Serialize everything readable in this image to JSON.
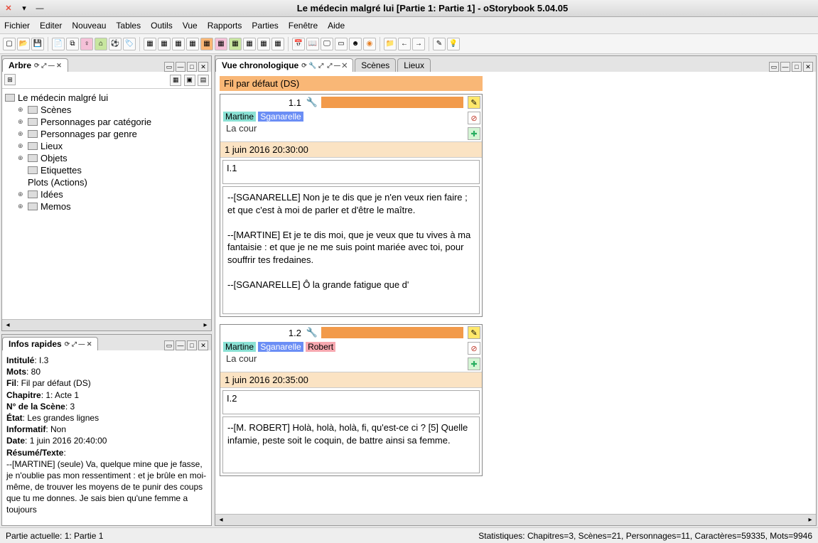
{
  "window": {
    "title": "Le médecin malgré lui [Partie 1: Partie 1] - oStorybook 5.04.05"
  },
  "menu": [
    "Fichier",
    "Editer",
    "Nouveau",
    "Tables",
    "Outils",
    "Vue",
    "Rapports",
    "Parties",
    "Fenêtre",
    "Aide"
  ],
  "panels": {
    "tree": {
      "title": "Arbre",
      "root": "Le médecin malgré lui",
      "items": [
        "Scènes",
        "Personnages par catégorie",
        "Personnages par genre",
        "Lieux",
        "Objets",
        "Etiquettes",
        "Plots (Actions)",
        "Idées",
        "Memos"
      ]
    },
    "infos": {
      "title": "Infos rapides",
      "fields": {
        "intitule_label": "Intitulé",
        "intitule": "I.3",
        "mots_label": "Mots",
        "mots": "80",
        "fil_label": "Fil",
        "fil": "Fil par défaut (DS)",
        "chap_label": "Chapitre",
        "chap": "1: Acte 1",
        "num_label": "N° de la Scène",
        "num": "3",
        "etat_label": "État",
        "etat": "Les grandes lignes",
        "info_label": "Informatif",
        "info": "Non",
        "date_label": "Date",
        "date": "1 juin 2016 20:40:00",
        "resume_label": "Résumé/Texte",
        "resume": "--[MARTINE] (seule) Va, quelque mine que je fasse, je n'oublie pas mon ressentiment : et je brûle en moi-même, de trouver les moyens de te punir des coups que tu me donnes. Je sais bien qu'une femme a toujours"
      }
    },
    "chrono": {
      "title": "Vue chronologique",
      "tabs": [
        "Scènes",
        "Lieux"
      ],
      "strand": "Fil par défaut (DS)",
      "scenes": [
        {
          "num": "1.1",
          "chars": [
            "Martine",
            "Sganarelle"
          ],
          "loc": "La cour",
          "date": "1 juin 2016 20:30:00",
          "titlefield": "I.1",
          "text": "--[SGANARELLE] Non je te dis que je n'en veux rien faire ; et que c'est à moi de parler et d'être le maître.\n\n--[MARTINE] Et je te dis moi, que je veux que tu vives à ma fantaisie : et que je ne me suis point mariée avec toi, pour souffrir tes fredaines.\n\n--[SGANARELLE] Ô la grande fatigue que d'"
        },
        {
          "num": "1.2",
          "chars": [
            "Martine",
            "Sganarelle",
            "Robert"
          ],
          "loc": "La cour",
          "date": "1 juin 2016 20:35:00",
          "titlefield": "I.2",
          "text": "--[M. ROBERT] Holà, holà, holà, fi, qu'est-ce ci ? [5] Quelle infamie, peste soit le coquin, de battre ainsi sa femme."
        }
      ]
    }
  },
  "status": {
    "left": "Partie actuelle: 1: Partie 1",
    "right": "Statistiques: Chapitres=3,  Scènes=21,  Personnages=11,  Caractères=59335,  Mots=9946"
  }
}
